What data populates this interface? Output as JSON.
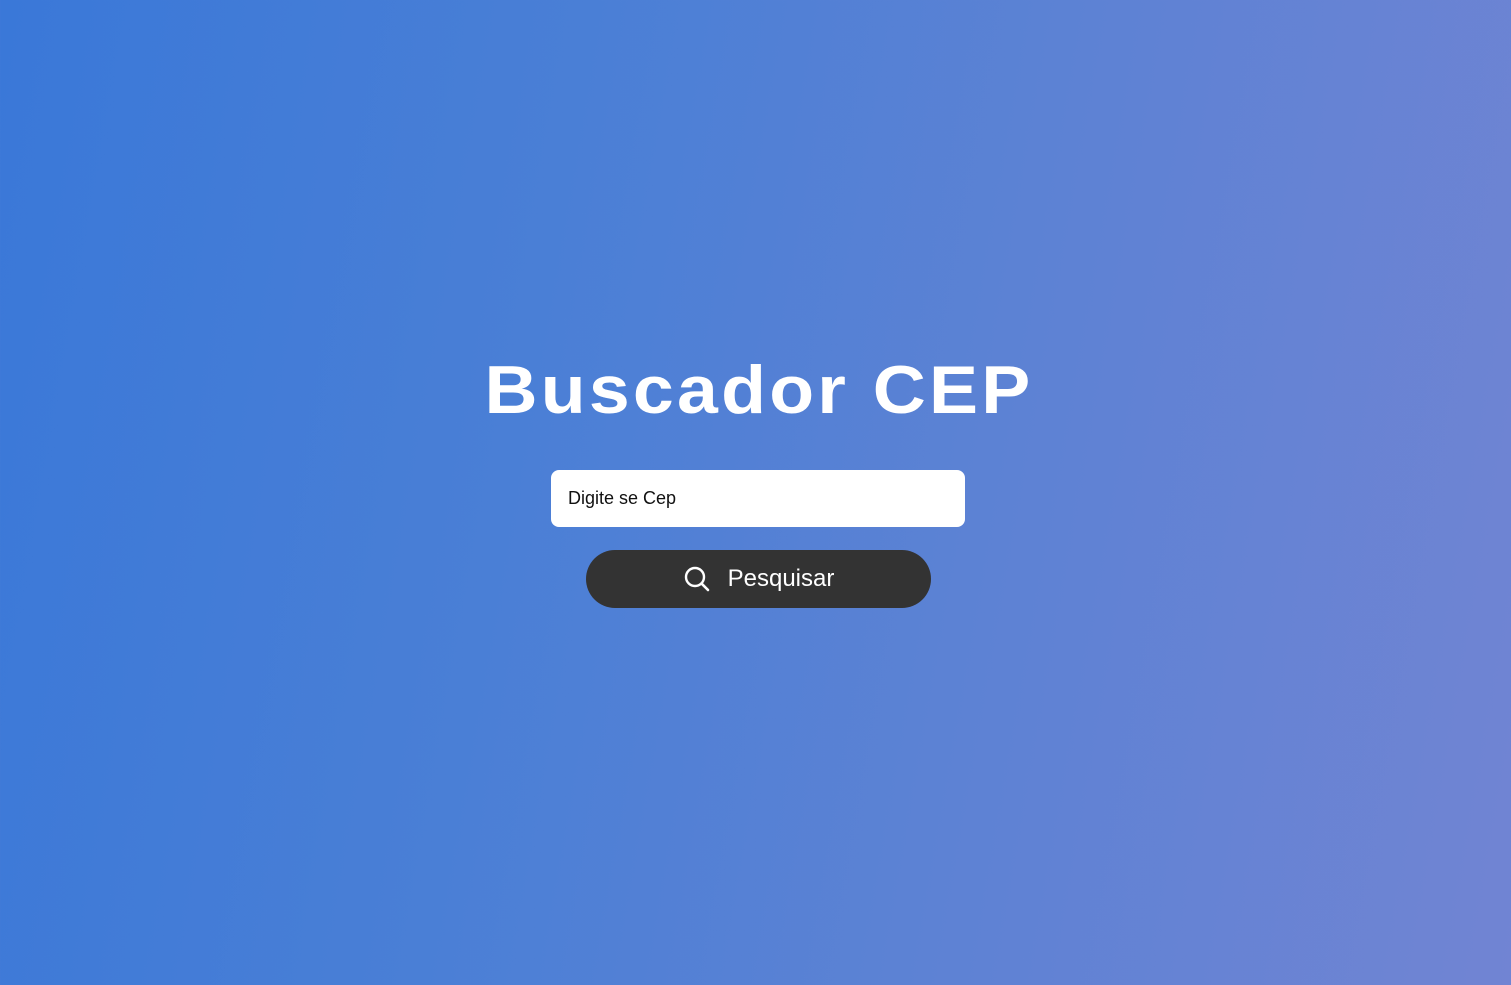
{
  "page": {
    "title": "Buscador CEP"
  },
  "search": {
    "placeholder": "Digite se Cep",
    "value": "",
    "button_label": "Pesquisar",
    "button_icon": "search-icon"
  },
  "colors": {
    "background_start": "#3a78d8",
    "background_end": "#7184d3",
    "title_text": "#ffffff",
    "button_background": "#333333",
    "input_background": "#ffffff"
  }
}
